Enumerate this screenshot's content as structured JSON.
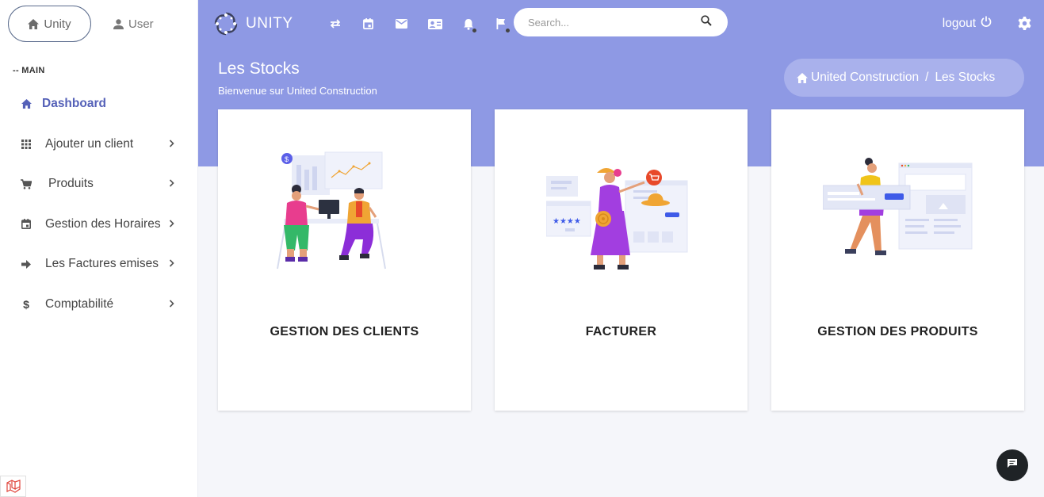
{
  "sidebar": {
    "tabs": [
      {
        "label": "Unity",
        "icon": "home-icon"
      },
      {
        "label": "User",
        "icon": "user-icon"
      }
    ],
    "section_label": "-- MAIN",
    "items": [
      {
        "label": "Dashboard",
        "icon": "home-icon",
        "active": true
      },
      {
        "label": "Ajouter un client",
        "icon": "grid-icon"
      },
      {
        "label": "Produits",
        "icon": "cart-icon"
      },
      {
        "label": "Gestion des Horaires",
        "icon": "calendar-icon"
      },
      {
        "label": "Les Factures emises",
        "icon": "arrow-right-icon"
      },
      {
        "label": "Comptabilité",
        "icon": "dollar-icon"
      }
    ]
  },
  "topbar": {
    "brand": "UNITY",
    "icons": [
      "swap-icon",
      "calendar-icon",
      "mail-icon",
      "contact-card-icon",
      "bell-icon",
      "flag-icon"
    ],
    "search_placeholder": "Search...",
    "logout_label": "logout"
  },
  "header": {
    "title": "Les Stocks",
    "subtitle": "Bienvenue sur United Construction",
    "breadcrumb": [
      "United Construction",
      "Les Stocks"
    ],
    "breadcrumb_sep": "/"
  },
  "cards": [
    {
      "title": "GESTION DES CLIENTS"
    },
    {
      "title": "FACTURER"
    },
    {
      "title": "GESTION DES PRODUITS"
    }
  ],
  "colors": {
    "accent": "#8e99e4",
    "active_menu": "#5561b8",
    "background": "#f5f6fa"
  }
}
